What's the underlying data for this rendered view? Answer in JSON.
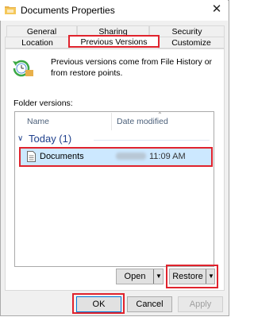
{
  "window": {
    "title": "Documents Properties",
    "close_glyph": "✕"
  },
  "tabs_top": [
    "General",
    "Sharing",
    "Security"
  ],
  "tabs_bottom": [
    "Location",
    "Previous Versions",
    "Customize"
  ],
  "info": {
    "text": "Previous versions come from File History or from restore points."
  },
  "folder_versions_label": "Folder versions:",
  "columns": {
    "name": "Name",
    "date": "Date modified"
  },
  "group": {
    "label": "Today (1)"
  },
  "row": {
    "name": "Documents",
    "time": "11:09 AM"
  },
  "buttons": {
    "open": "Open",
    "restore": "Restore",
    "ok": "OK",
    "cancel": "Cancel",
    "apply": "Apply"
  },
  "colors": {
    "highlight": "#e0232d",
    "selection": "#cce8ff",
    "group": "#1e3f8c"
  }
}
